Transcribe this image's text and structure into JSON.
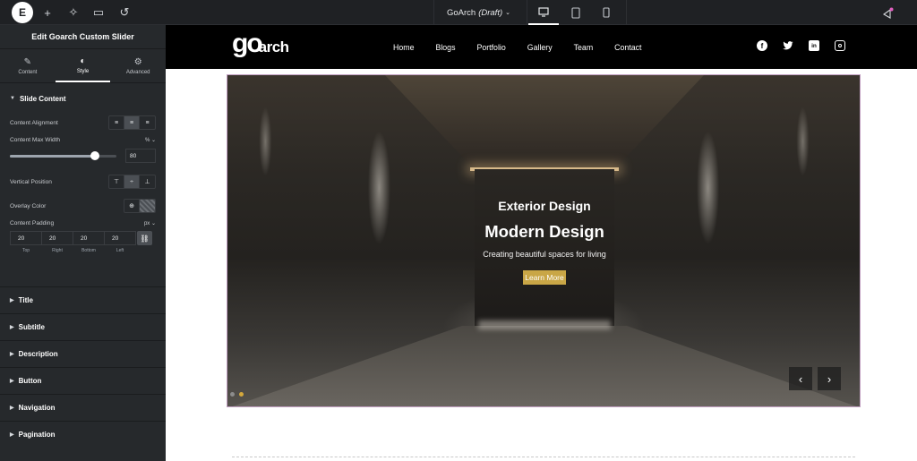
{
  "topbar": {
    "logo_letter": "E",
    "doc_name": "GoArch",
    "doc_status": "(Draft)",
    "colors": {
      "bar": "#1f2124"
    }
  },
  "panel": {
    "title": "Edit Goarch Custom Slider",
    "tabs": [
      {
        "label": "Content",
        "icon": "pencil-icon"
      },
      {
        "label": "Style",
        "icon": "half-circle-icon",
        "active": true
      },
      {
        "label": "Advanced",
        "icon": "gear-icon"
      }
    ],
    "slide_content": {
      "title": "Slide Content",
      "content_alignment_label": "Content Alignment",
      "content_max_width_label": "Content Max Width",
      "content_max_width_unit": "%",
      "content_max_width_value": "80",
      "content_max_width_fraction": 0.8,
      "vertical_position_label": "Vertical Position",
      "overlay_color_label": "Overlay Color",
      "content_padding_label": "Content Padding",
      "content_padding_unit": "px",
      "padding": {
        "top": "20",
        "right": "20",
        "bottom": "20",
        "left": "20"
      },
      "padding_labels": {
        "top": "Top",
        "right": "Right",
        "bottom": "Bottom",
        "left": "Left"
      }
    },
    "sections": [
      "Title",
      "Subtitle",
      "Description",
      "Button",
      "Navigation",
      "Pagination"
    ]
  },
  "site": {
    "brand_main": "go",
    "brand_sub": "arch",
    "nav": [
      "Home",
      "Blogs",
      "Portfolio",
      "Gallery",
      "Team",
      "Contact"
    ],
    "social": [
      "facebook-icon",
      "twitter-icon",
      "linkedin-icon",
      "instagram-icon"
    ],
    "slide": {
      "subtitle": "Exterior Design",
      "title": "Modern Design",
      "description": "Creating beautiful spaces for living",
      "button": "Learn More",
      "prev": "‹",
      "next": "›"
    },
    "colors": {
      "accent": "#c9a646",
      "header": "#000000"
    }
  }
}
